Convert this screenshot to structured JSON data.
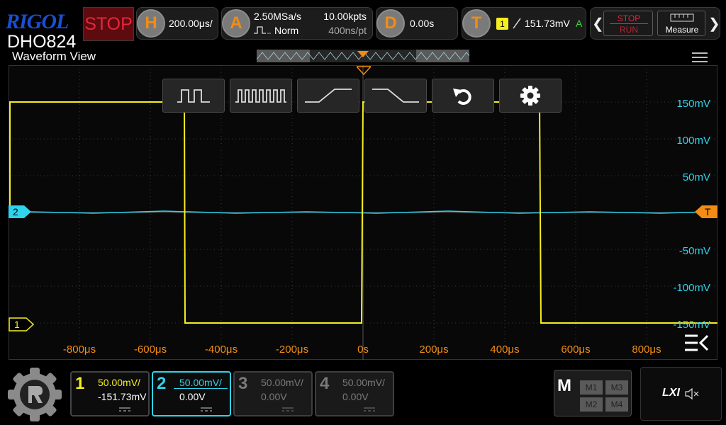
{
  "brand": {
    "logo": "RIGOL",
    "model": "DHO824"
  },
  "run_state": {
    "label": "STOP"
  },
  "horizontal": {
    "key": "H",
    "timebase": "200.00μs/"
  },
  "acquire": {
    "key": "A",
    "sample_rate": "2.50MSa/s",
    "mode": "Norm",
    "memory": "10.00kpts",
    "resolution": "400ns/pt"
  },
  "delay": {
    "key": "D",
    "value": "0.00s"
  },
  "trigger": {
    "key": "T",
    "source": "1",
    "level": "151.73mV",
    "sweep": "A"
  },
  "right_buttons": {
    "stop_label": "STOP",
    "run_label": "RUN",
    "measure_label": "Measure"
  },
  "waveform_view": {
    "title": "Waveform View",
    "volt_labels": [
      "150mV",
      "100mV",
      "50mV",
      "-50mV",
      "-100mV",
      "-150mV"
    ],
    "time_labels": [
      "-800μs",
      "-600μs",
      "-400μs",
      "-200μs",
      "0s",
      "200μs",
      "400μs",
      "600μs",
      "800μs"
    ],
    "ch1_marker": "1",
    "ch2_marker": "2",
    "trigger_marker": "T"
  },
  "toolbar": {
    "icons": [
      "square-wave-icon",
      "dense-square-wave-icon",
      "rising-edge-icon",
      "falling-edge-icon",
      "undo-icon",
      "gear-icon"
    ]
  },
  "channels": [
    {
      "num": "1",
      "scale": "50.00mV/",
      "offset": "-151.73mV",
      "color": "#f5ef1f",
      "active": true
    },
    {
      "num": "2",
      "scale": "50.00mV/",
      "offset": "0.00V",
      "color": "#2fd3ec",
      "active": true,
      "selected": true
    },
    {
      "num": "3",
      "scale": "50.00mV/",
      "offset": "0.00V",
      "color": "#7a7a7a",
      "active": false
    },
    {
      "num": "4",
      "scale": "50.00mV/",
      "offset": "0.00V",
      "color": "#7a7a7a",
      "active": false
    }
  ],
  "math": {
    "key": "M",
    "slots": [
      "M1",
      "M3",
      "M2",
      "M4"
    ]
  },
  "status": {
    "lxi": "LXI"
  },
  "colors": {
    "ch1": "#f5ef1f",
    "ch2": "#2fd3ec",
    "trigger": "#f28c12",
    "stop": "#e2283b",
    "brand": "#1a4fd0"
  }
}
